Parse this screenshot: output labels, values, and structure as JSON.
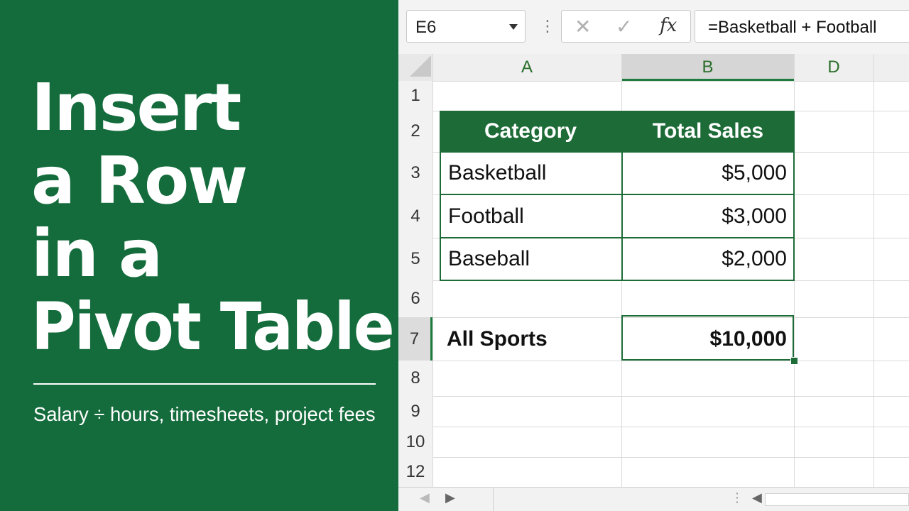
{
  "banner": {
    "title_lines": [
      "Insert",
      "a Row",
      "in a",
      "Pivot Table"
    ],
    "subtitle": "Salary ÷ hours, timesheets, project fees",
    "background": "#146c3c"
  },
  "formula_bar": {
    "name_box": "E6",
    "formula": "=Basketball + Football",
    "fx_label": "fx"
  },
  "sheet": {
    "columns": [
      "A",
      "B",
      "D"
    ],
    "selected_column": "B",
    "rows": [
      "1",
      "2",
      "3",
      "4",
      "5",
      "6",
      "7",
      "8",
      "9",
      "10",
      "12"
    ],
    "active_row": "7",
    "table": {
      "headers": [
        "Category",
        "Total Sales"
      ],
      "rows": [
        [
          "Basketball",
          "$5,000"
        ],
        [
          "Football",
          "$3,000"
        ],
        [
          "Baseball",
          "$2,000"
        ]
      ],
      "header_color": "#1d6b37"
    },
    "total": {
      "label": "All Sports",
      "value": "$10,000"
    }
  }
}
